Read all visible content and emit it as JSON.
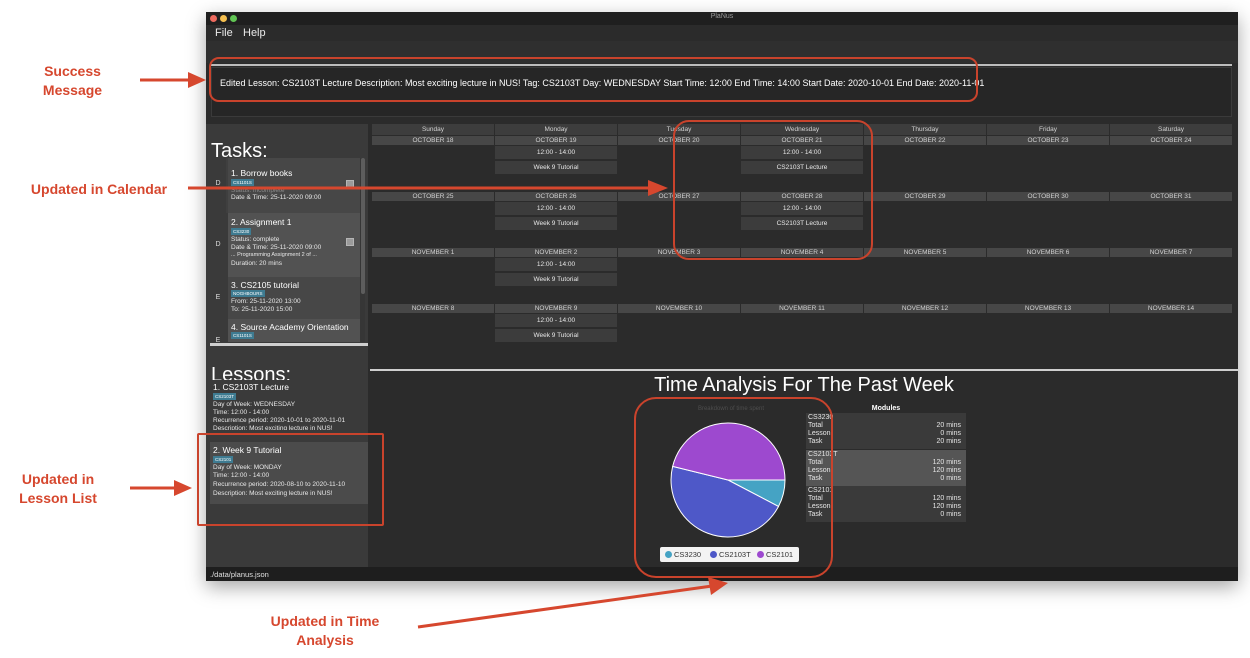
{
  "window": {
    "title": "PlaNus"
  },
  "menu": {
    "items": [
      "File",
      "Help"
    ]
  },
  "result": {
    "message": "Edited Lesson: CS2103T Lecture Description: Most exciting lecture in NUS! Tag: CS2103T Day: WEDNESDAY Start Time: 12:00 End Time: 14:00 Start Date: 2020-10-01 End Date: 2020-11-01"
  },
  "tasks": {
    "header": "Tasks:",
    "cards": [
      {
        "letter": "D",
        "title": "1.  Borrow books",
        "tag": "CS1101S",
        "lines": [
          "Status:  incomplete",
          "Date & Time:  25-11-2020 09:00"
        ]
      },
      {
        "letter": "D",
        "title": "2.  Assignment 1",
        "tag": "CS3230",
        "lines": [
          "Status:  complete",
          "Date & Time:  25-11-2020 09:00",
          "...  Programming Assignment 2 of ...",
          "Duration:  20 mins"
        ]
      },
      {
        "letter": "E",
        "title": "3.  CS2105 tutorial",
        "tag": "NOGHBOURS",
        "lines": [
          "From:  25-11-2020 13:00",
          "To:  25-11-2020 15:00"
        ]
      },
      {
        "letter": "E",
        "title": "4.  Source Academy Orientation",
        "tag": "CS1101S",
        "lines": []
      }
    ]
  },
  "lessons": {
    "header": "Lessons:",
    "cards": [
      {
        "title": "1.  CS2103T Lecture",
        "tag": "CS2103T",
        "lines": [
          "Day of Week:  WEDNESDAY",
          "Time:  12:00 - 14:00",
          "Recurrence period:  2020-10-01 to 2020-11-01",
          "Description:  Most exciting lecture in NUS!"
        ]
      },
      {
        "title": "2.  Week 9 Tutorial",
        "tag": "CS2101",
        "lines": [
          "Day of Week:  MONDAY",
          "Time:  12:00 - 14:00",
          "Recurrence period:  2020-08-10 to 2020-11-10",
          "Description:  Most exciting lecture in NUS!"
        ]
      }
    ]
  },
  "calendar": {
    "days": [
      "Sunday",
      "Monday",
      "Tuesday",
      "Wednesday",
      "Thursday",
      "Friday",
      "Saturday"
    ],
    "weeks": [
      {
        "dates": [
          "OCTOBER 18",
          "OCTOBER 19",
          "OCTOBER 20",
          "OCTOBER 21",
          "OCTOBER 22",
          "OCTOBER 23",
          "OCTOBER 24"
        ],
        "events": [
          [],
          [
            "12:00 - 14:00",
            "Week 9 Tutorial"
          ],
          [],
          [
            "12:00 - 14:00",
            "CS2103T Lecture"
          ],
          [],
          [],
          []
        ]
      },
      {
        "dates": [
          "OCTOBER 25",
          "OCTOBER 26",
          "OCTOBER 27",
          "OCTOBER 28",
          "OCTOBER 29",
          "OCTOBER 30",
          "OCTOBER 31"
        ],
        "events": [
          [],
          [
            "12:00 - 14:00",
            "Week 9 Tutorial"
          ],
          [],
          [
            "12:00 - 14:00",
            "CS2103T Lecture"
          ],
          [],
          [],
          []
        ]
      },
      {
        "dates": [
          "NOVEMBER 1",
          "NOVEMBER 2",
          "NOVEMBER 3",
          "NOVEMBER 4",
          "NOVEMBER 5",
          "NOVEMBER 6",
          "NOVEMBER 7"
        ],
        "events": [
          [],
          [
            "12:00 - 14:00",
            "Week 9 Tutorial"
          ],
          [],
          [],
          [],
          [],
          []
        ]
      },
      {
        "dates": [
          "NOVEMBER 8",
          "NOVEMBER 9",
          "NOVEMBER 10",
          "NOVEMBER 11",
          "NOVEMBER 12",
          "NOVEMBER 13",
          "NOVEMBER 14"
        ],
        "events": [
          [],
          [
            "12:00 - 14:00",
            "Week 9 Tutorial"
          ],
          [],
          [],
          [],
          [],
          []
        ]
      }
    ]
  },
  "time_analysis": {
    "title": "Time Analysis For The Past Week",
    "pie_title": "Breakdown of time spent",
    "modules_header": "Modules",
    "modules": [
      {
        "name": "CS3230",
        "rows": [
          [
            "Total",
            "20 mins"
          ],
          [
            "Lesson",
            "0 mins"
          ],
          [
            "Task",
            "20 mins"
          ]
        ]
      },
      {
        "name": "CS2103T",
        "rows": [
          [
            "Total",
            "120 mins"
          ],
          [
            "Lesson",
            "120 mins"
          ],
          [
            "Task",
            "0 mins"
          ]
        ]
      },
      {
        "name": "CS2101",
        "rows": [
          [
            "Total",
            "120 mins"
          ],
          [
            "Lesson",
            "120 mins"
          ],
          [
            "Task",
            "0 mins"
          ]
        ]
      }
    ]
  },
  "chart_data": {
    "type": "pie",
    "title": "Breakdown of time spent",
    "categories": [
      "CS3230",
      "CS2103T",
      "CS2101"
    ],
    "values": [
      20,
      120,
      120
    ],
    "colors": [
      "#45a3c4",
      "#4e58c8",
      "#9d49cf"
    ],
    "legend": "bottom"
  },
  "status_bar": {
    "path": "./data/planus.json"
  },
  "annotations": {
    "success": "Success Message",
    "calendar": "Updated in Calendar",
    "lesson_list": "Updated in Lesson List",
    "time_analysis": "Updated in Time Analysis"
  }
}
